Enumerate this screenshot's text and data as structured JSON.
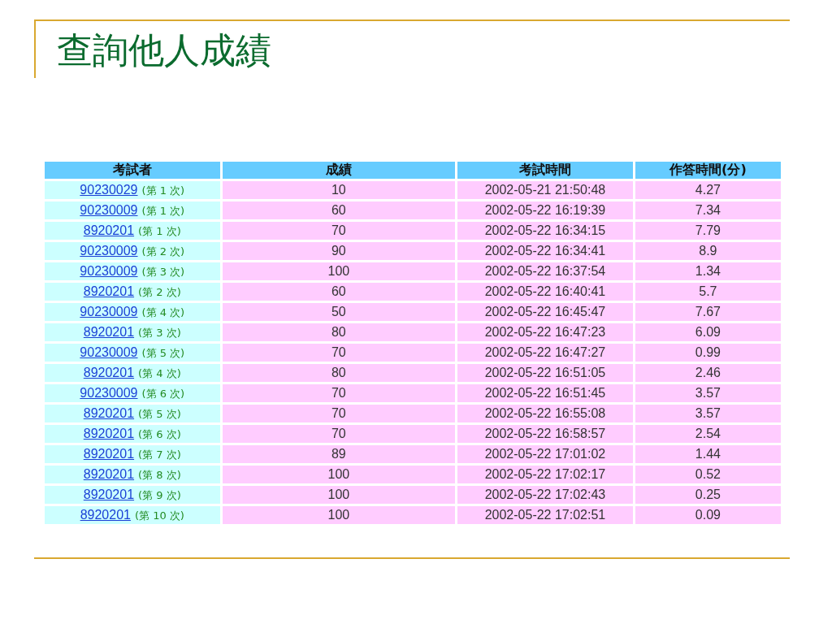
{
  "title": "查詢他人成績",
  "table": {
    "columns": [
      "考試者",
      "成績",
      "考試時間",
      "作答時間(分)"
    ],
    "rows": [
      {
        "examinee": "90230029",
        "attempt": "(第 1 次)",
        "score": "10",
        "time": "2002-05-21 21:50:48",
        "duration": "4.27"
      },
      {
        "examinee": "90230009",
        "attempt": "(第 1 次)",
        "score": "60",
        "time": "2002-05-22 16:19:39",
        "duration": "7.34"
      },
      {
        "examinee": "8920201",
        "attempt": "(第 1 次)",
        "score": "70",
        "time": "2002-05-22 16:34:15",
        "duration": "7.79"
      },
      {
        "examinee": "90230009",
        "attempt": "(第 2 次)",
        "score": "90",
        "time": "2002-05-22 16:34:41",
        "duration": "8.9"
      },
      {
        "examinee": "90230009",
        "attempt": "(第 3 次)",
        "score": "100",
        "time": "2002-05-22 16:37:54",
        "duration": "1.34"
      },
      {
        "examinee": "8920201",
        "attempt": "(第 2 次)",
        "score": "60",
        "time": "2002-05-22 16:40:41",
        "duration": "5.7"
      },
      {
        "examinee": "90230009",
        "attempt": "(第 4 次)",
        "score": "50",
        "time": "2002-05-22 16:45:47",
        "duration": "7.67"
      },
      {
        "examinee": "8920201",
        "attempt": "(第 3 次)",
        "score": "80",
        "time": "2002-05-22 16:47:23",
        "duration": "6.09"
      },
      {
        "examinee": "90230009",
        "attempt": "(第 5 次)",
        "score": "70",
        "time": "2002-05-22 16:47:27",
        "duration": "0.99"
      },
      {
        "examinee": "8920201",
        "attempt": "(第 4 次)",
        "score": "80",
        "time": "2002-05-22 16:51:05",
        "duration": "2.46"
      },
      {
        "examinee": "90230009",
        "attempt": "(第 6 次)",
        "score": "70",
        "time": "2002-05-22 16:51:45",
        "duration": "3.57"
      },
      {
        "examinee": "8920201",
        "attempt": "(第 5 次)",
        "score": "70",
        "time": "2002-05-22 16:55:08",
        "duration": "3.57"
      },
      {
        "examinee": "8920201",
        "attempt": "(第 6 次)",
        "score": "70",
        "time": "2002-05-22 16:58:57",
        "duration": "2.54"
      },
      {
        "examinee": "8920201",
        "attempt": "(第 7 次)",
        "score": "89",
        "time": "2002-05-22 17:01:02",
        "duration": "1.44"
      },
      {
        "examinee": "8920201",
        "attempt": "(第 8 次)",
        "score": "100",
        "time": "2002-05-22 17:02:17",
        "duration": "0.52"
      },
      {
        "examinee": "8920201",
        "attempt": "(第 9 次)",
        "score": "100",
        "time": "2002-05-22 17:02:43",
        "duration": "0.25"
      },
      {
        "examinee": "8920201",
        "attempt": "(第 10 次)",
        "score": "100",
        "time": "2002-05-22 17:02:51",
        "duration": "0.09"
      }
    ]
  }
}
